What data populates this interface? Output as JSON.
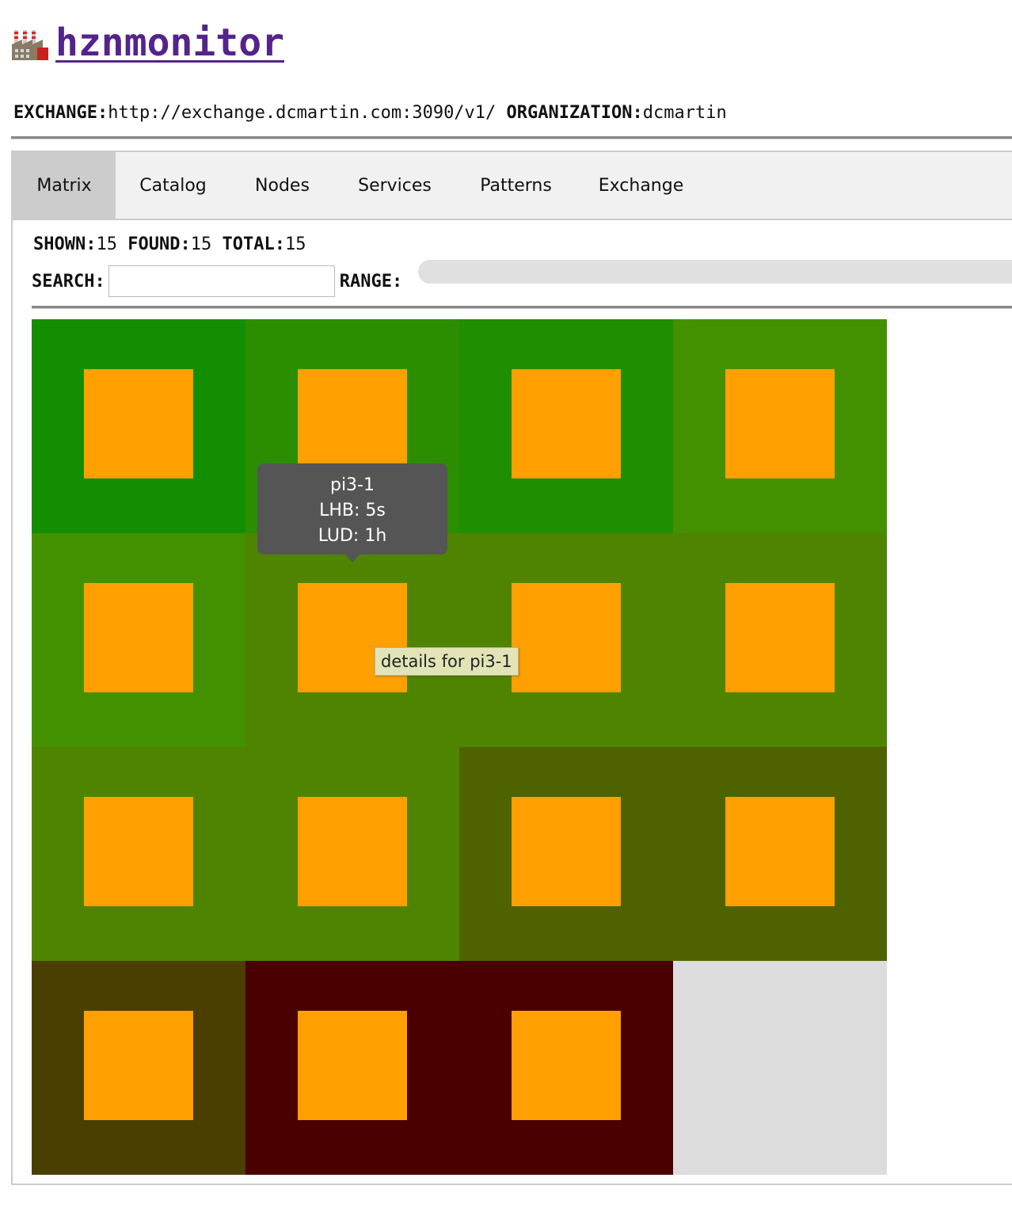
{
  "header": {
    "title": "hznmonitor",
    "icon": "factory-icon"
  },
  "meta": {
    "exchange_label": "EXCHANGE:",
    "exchange_value": "http://exchange.dcmartin.com:3090/v1/",
    "organization_label": "ORGANIZATION:",
    "organization_value": "dcmartin"
  },
  "tabs": [
    {
      "label": "Matrix",
      "active": true
    },
    {
      "label": "Catalog",
      "active": false
    },
    {
      "label": "Nodes",
      "active": false
    },
    {
      "label": "Services",
      "active": false
    },
    {
      "label": "Patterns",
      "active": false
    },
    {
      "label": "Exchange",
      "active": false
    }
  ],
  "stats": {
    "shown_label": "SHOWN:",
    "shown_value": "15",
    "found_label": "FOUND:",
    "found_value": "15",
    "total_label": "TOTAL:",
    "total_value": "15"
  },
  "search": {
    "label": "SEARCH:",
    "value": "",
    "placeholder": ""
  },
  "range": {
    "label": "RANGE:"
  },
  "colors": {
    "title": "#54248a",
    "node_inner": "#ff9f00",
    "empty_cell": "#dcdcdc",
    "tooltip_bg": "#555555"
  },
  "matrix": {
    "cells": [
      {
        "color": "#138e00",
        "empty": false
      },
      {
        "color": "#2b8e00",
        "empty": false
      },
      {
        "color": "#1f8e00",
        "empty": false
      },
      {
        "color": "#439100",
        "empty": false
      },
      {
        "color": "#439100",
        "empty": false
      },
      {
        "color": "#4f8400",
        "empty": false
      },
      {
        "color": "#4f8400",
        "empty": false
      },
      {
        "color": "#4f8400",
        "empty": false
      },
      {
        "color": "#4f8400",
        "empty": false
      },
      {
        "color": "#4f8400",
        "empty": false
      },
      {
        "color": "#4e6200",
        "empty": false
      },
      {
        "color": "#4e6200",
        "empty": false
      },
      {
        "color": "#4b3f00",
        "empty": false
      },
      {
        "color": "#4b0000",
        "empty": false
      },
      {
        "color": "#4b0000",
        "empty": false
      },
      {
        "color": "#dcdcdc",
        "empty": true
      }
    ]
  },
  "tooltip": {
    "name": "pi3-1",
    "lhb": "LHB: 5s",
    "lud": "LUD: 1h"
  },
  "title_tip": {
    "text": "details for pi3-1"
  }
}
